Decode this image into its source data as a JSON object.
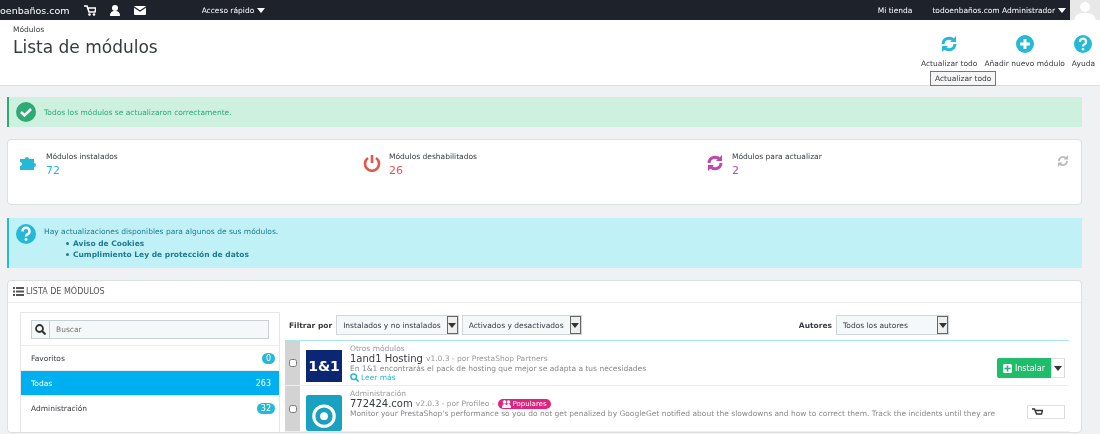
{
  "topbar": {
    "shop_name": "oenbaños.com",
    "quick_access": "Acceso rápido",
    "store_link": "Mi tienda",
    "user": "todoenbaños.com Administrador"
  },
  "header": {
    "breadcrumb": "Módulos",
    "title": "Lista de módulos",
    "toolbar": [
      {
        "kind": "refresh",
        "label": "Actualizar todo"
      },
      {
        "kind": "add",
        "label": "Añadir nuevo módulo"
      },
      {
        "kind": "help",
        "label": "Ayuda"
      }
    ],
    "tooltip": "Actualizar todo"
  },
  "success_alert": "Todos los módulos se actualizaron correctamente.",
  "stats": [
    {
      "kind": "installed",
      "label": "Módulos instalados",
      "value": "72",
      "color": "#25b9d7"
    },
    {
      "kind": "disabled",
      "label": "Módulos deshabilitados",
      "value": "26",
      "color": "#e3564b"
    },
    {
      "kind": "update",
      "label": "Módulos para actualizar",
      "value": "2",
      "color": "#c147a8"
    }
  ],
  "info_alert": {
    "text": "Hay actualizaciones disponibles para algunos de sus módulos.",
    "links": [
      "Aviso de Cookies",
      "Cumplimiento Ley de protección de datos"
    ]
  },
  "module_list": {
    "title": "LISTA DE MÓDULOS",
    "search": {
      "placeholder": "Buscar"
    },
    "categories": [
      {
        "label": "Favoritos",
        "count": "0",
        "selected": false
      },
      {
        "label": "Todas",
        "count": "263",
        "selected": true
      },
      {
        "label": "Administración",
        "count": "32",
        "selected": false
      }
    ],
    "filter_label": "Filtrar por",
    "filters": [
      "Instalados y no instalados",
      "Activados y desactivados"
    ],
    "authors_label": "Autores",
    "authors": "Todos los autores",
    "modules": [
      {
        "logo": "1&1",
        "category": "Otros módulos",
        "name": "1and1 Hosting",
        "meta": "v1.0.3 - por PrestaShop Partners",
        "description": "En 1&1 encontrarás el pack de hosting que mejor se adapta a tus necesidades",
        "read_more": "Leer más",
        "action": "Instalar",
        "checked": false
      },
      {
        "category": "Administración",
        "name": "772424.com",
        "meta": "v2.0.3 - por Profileo -",
        "badge": "Populares",
        "description": "Monitor your PrestaShop's performance so you do not get penalized by GoogleGet notified about the slowdowns and how to correct them. Track the incidents until they are",
        "checked": false
      }
    ]
  }
}
